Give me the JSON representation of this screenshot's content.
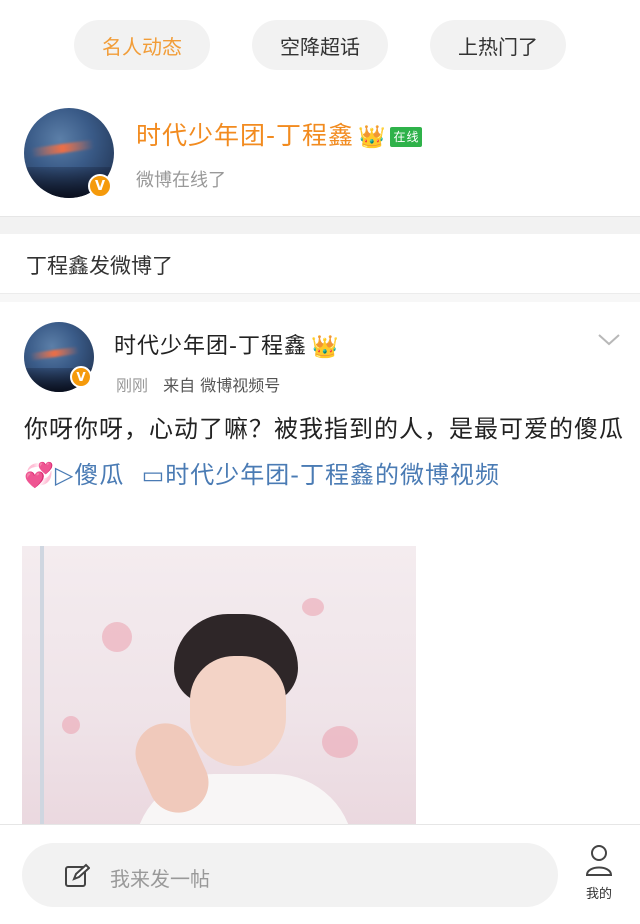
{
  "tabs": [
    {
      "label": "名人动态",
      "active": true
    },
    {
      "label": "空降超话",
      "active": false
    },
    {
      "label": "上热门了",
      "active": false
    }
  ],
  "profile": {
    "name": "时代少年团-丁程鑫",
    "crown": "👑",
    "online_badge": "在线",
    "subtitle": "微博在线了",
    "verified": "V"
  },
  "section": {
    "title": "丁程鑫发微博了"
  },
  "post": {
    "author": "时代少年团-丁程鑫",
    "crown": "👑",
    "time": "刚刚",
    "source_prefix": "来自",
    "source": "微博视频号",
    "verified": "V",
    "text": "你呀你呀，心动了嘛？被我指到的人，是最可爱的傻瓜",
    "emoji": "💞",
    "topic_link": "▷傻瓜",
    "video_link": "▭时代少年团-丁程鑫的微博视频"
  },
  "bottom": {
    "compose_placeholder": "我来发一帖",
    "me_label": "我的"
  },
  "colors": {
    "accent_orange": "#f28b1f",
    "link_blue": "#4a7bb4",
    "online_green": "#2fb24a",
    "verified_orange": "#f59a0b"
  },
  "icons": [
    "chevron-down-icon",
    "edit-icon",
    "user-icon",
    "crown-icon"
  ]
}
